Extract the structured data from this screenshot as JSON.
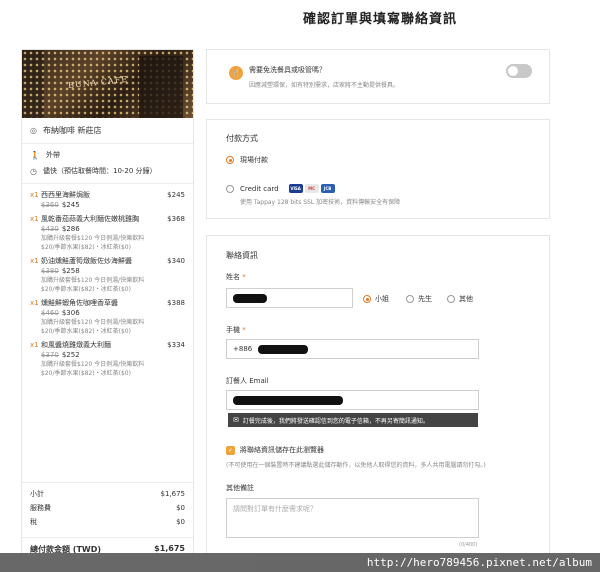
{
  "page_title": "確認訂單與填寫聯絡資訊",
  "store": {
    "sign_text": "BUNA CAFE",
    "name": "布納咖啡 新莊店",
    "order_type": "外帶",
    "pickup_time": "儘快（預估取餐時間：10-20 分鐘）"
  },
  "items": [
    {
      "qty": "x1",
      "name": "西西里海鮮焗飯",
      "old_price": "$360",
      "new_price": "$245",
      "note": "",
      "price": "$245"
    },
    {
      "qty": "x1",
      "name": "風乾番茄蒜義大利麵佐嫩桃雞胸",
      "old_price": "$430",
      "new_price": "$286",
      "note": "加購升級套餐$120 今日例湯/快樂飲料$20/季節水果($82)・冰紅茶($0)",
      "price": "$368"
    },
    {
      "qty": "x1",
      "name": "奶油燻鮭蘆筍燉飯佐炒海鮮醬",
      "old_price": "$380",
      "new_price": "$258",
      "note": "加購升級套餐$120 今日例湯/快樂飲料$20/季節水果($82)・冰紅茶($0)",
      "price": "$340"
    },
    {
      "qty": "x1",
      "name": "燻鮭鮮蝦角佐咖哩香草醬",
      "old_price": "$460",
      "new_price": "$306",
      "note": "加購升級套餐$120 今日例湯/快樂飲料$20/季節水果($82)・冰紅茶($0)",
      "price": "$388"
    },
    {
      "qty": "x1",
      "name": "和風醬燒雞燉義大利麵",
      "old_price": "$370",
      "new_price": "$252",
      "note": "加購升級套餐$120 今日例湯/快樂飲料$20/季節水果($82)・冰紅茶($0)",
      "price": "$334"
    }
  ],
  "totals": {
    "subtotal_label": "小計",
    "subtotal": "$1,675",
    "service_label": "服務費",
    "service": "$0",
    "tax_label": "稅",
    "tax": "$0",
    "grand_label": "總付款金額 (TWD)",
    "grand": "$1,675"
  },
  "utensils": {
    "title": "需要免洗餐具或吸管嗎？",
    "hint": "因應減塑環保，如有特別需求，店家將不主動提供餐具。"
  },
  "payment": {
    "title": "付款方式",
    "option_cash": "現場付款",
    "option_card": "Credit card",
    "card_brands": [
      "VISA",
      "MC",
      "JCB"
    ],
    "card_hint": "使用 Tappay 128 bits SSL 加密技術，資料傳輸安全有保障"
  },
  "contact": {
    "title": "聯絡資訊",
    "name_label": "姓名",
    "required_mark": "*",
    "title_options": [
      "小姐",
      "先生",
      "其他"
    ],
    "phone_label": "手機",
    "phone_prefix": "+886",
    "email_label": "訂餐人 Email",
    "email_tooltip": "訂餐完成後，我們將發送確認信到您的電子信箱，不再另寄簡訊通知。",
    "save_label": "將聯絡資訊儲存在此瀏覽器",
    "save_hint": "(不可使用在一個裝置時不建議點選此儲存動作，以免他人取得您的資料，多人共用電腦請勿打勾。)",
    "remark_label": "其他備註",
    "remark_placeholder": "請問對訂單有什麼需求呢？",
    "remark_counter": "(0/400)"
  },
  "watermark": "http://hero789456.pixnet.net/album",
  "colors": {
    "accent": "#e07a22",
    "border": "#e5e5e5",
    "watermark_bg": "#5b5b5b"
  }
}
